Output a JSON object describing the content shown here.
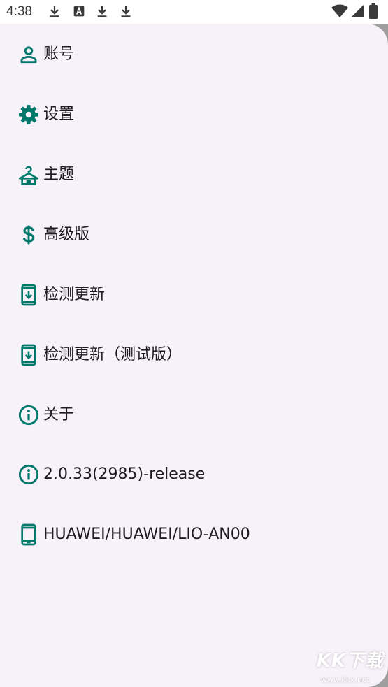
{
  "status_bar": {
    "time": "4:38",
    "icons": [
      "download-icon",
      "font-app-icon",
      "download-icon",
      "download-icon",
      "wifi-icon",
      "signal-icon",
      "battery-icon"
    ]
  },
  "menu": {
    "items": [
      {
        "label": "账号",
        "icon": "person-icon"
      },
      {
        "label": "设置",
        "icon": "gear-icon"
      },
      {
        "label": "主题",
        "icon": "hanger-icon"
      },
      {
        "label": "高级版",
        "icon": "dollar-icon"
      },
      {
        "label": "检测更新",
        "icon": "phone-download-icon"
      },
      {
        "label": "检测更新（测试版）",
        "icon": "phone-download-icon"
      },
      {
        "label": "关于",
        "icon": "info-icon"
      },
      {
        "label": "2.0.33(2985)-release",
        "icon": "info-icon"
      },
      {
        "label": "HUAWEI/HUAWEI/LIO-AN00",
        "icon": "phone-icon"
      }
    ]
  },
  "watermark": {
    "title": "KK下载",
    "url": "www.kkx.net"
  },
  "colors": {
    "accent": "#00796b",
    "drawer_bg": "#f7f1fa",
    "text": "#1c1b1f"
  }
}
